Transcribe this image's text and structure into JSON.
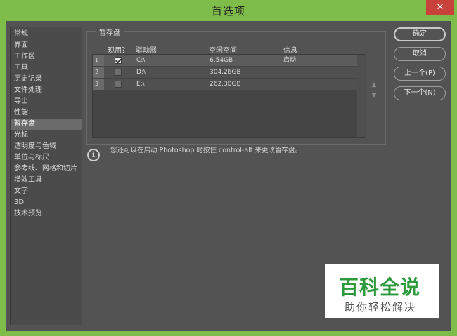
{
  "title": "首选项",
  "close_symbol": "✕",
  "sidebar": {
    "items": [
      "常规",
      "界面",
      "工作区",
      "工具",
      "历史记录",
      "文件处理",
      "导出",
      "性能",
      "暂存盘",
      "光标",
      "透明度与色域",
      "单位与标尺",
      "参考线、网格和切片",
      "增效工具",
      "文字",
      "3D",
      "技术预览"
    ],
    "active_index": 8
  },
  "scratch": {
    "group_title": "暂存盘",
    "headers": {
      "active": "现用？",
      "drive": "驱动器",
      "free": "空闲空间",
      "info": "信息"
    },
    "rows": [
      {
        "num": "1",
        "checked": true,
        "drive": "C:\\",
        "free": "6.54GB",
        "info": "启动"
      },
      {
        "num": "2",
        "checked": false,
        "drive": "D:\\",
        "free": "304.26GB",
        "info": ""
      },
      {
        "num": "3",
        "checked": false,
        "drive": "E:\\",
        "free": "262.30GB",
        "info": ""
      }
    ],
    "up_arrow": "▲",
    "down_arrow": "▼",
    "info_symbol": "i",
    "info_text": "您还可以在启动 Photoshop 时按住 control-alt 来更改暂存盘。"
  },
  "buttons": {
    "ok": "确定",
    "cancel": "取消",
    "prev": "上一个(P)",
    "next": "下一个(N)"
  },
  "watermark": {
    "top": "百科全说",
    "bottom": "助你轻松解决"
  },
  "colors": {
    "titlebar": "#7fbd4a",
    "panel": "#535353",
    "close": "#c8413b",
    "watermark_green": "#2d9a3b"
  }
}
